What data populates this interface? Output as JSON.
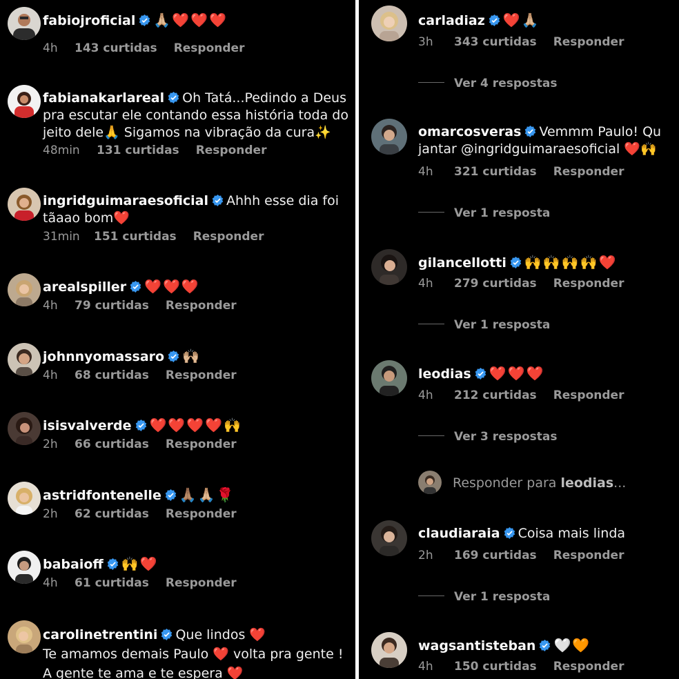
{
  "left": {
    "comments": [
      {
        "user": "fabiojroficial",
        "text": "",
        "emoji": "🙏🏼❤️❤️❤️",
        "time": "4h",
        "likes": "143 curtidas",
        "reply": "Responder"
      },
      {
        "user": "fabianakarlareal",
        "text": "Oh Tatá...Pedindo a Deus",
        "line2": "pra escutar ele contando essa história toda do",
        "line3": "jeito dele🙏 Sigamos na vibração da cura✨",
        "time": "48min",
        "likes": "131 curtidas",
        "reply": "Responder"
      },
      {
        "user": "ingridguimaraesoficial",
        "text": "Ahhh esse dia foi",
        "line2": "tãaao bom❤️",
        "time": "31min",
        "likes": "151 curtidas",
        "reply": "Responder"
      },
      {
        "user": "arealspiller",
        "text": "",
        "emoji": "❤️❤️❤️",
        "time": "4h",
        "likes": "79 curtidas",
        "reply": "Responder"
      },
      {
        "user": "johnnyomassaro",
        "text": "",
        "emoji": "🙌🏼",
        "time": "4h",
        "likes": "68 curtidas",
        "reply": "Responder"
      },
      {
        "user": "isisvalverde",
        "text": "",
        "emoji": "❤️❤️❤️❤️🙌",
        "time": "2h",
        "likes": "66 curtidas",
        "reply": "Responder"
      },
      {
        "user": "astridfontenelle",
        "text": "",
        "emoji": "🙏🏽🙏🏼🌹",
        "time": "2h",
        "likes": "62 curtidas",
        "reply": "Responder"
      },
      {
        "user": "babaioff",
        "text": "",
        "emoji": "🙌❤️",
        "time": "4h",
        "likes": "61 curtidas",
        "reply": "Responder"
      },
      {
        "user": "carolinetrentini",
        "text": "Que lindos ❤️",
        "line2": "Te amamos demais Paulo ❤️ volta pra gente !",
        "line3": "A gente te ama e te espera ❤️"
      }
    ]
  },
  "right": {
    "comments": [
      {
        "user": "carladiaz",
        "text": "",
        "emoji": "❤️🙏🏼",
        "time": "3h",
        "likes": "343 curtidas",
        "reply": "Responder",
        "view": "Ver 4 respostas"
      },
      {
        "user": "omarcosveras",
        "text": "Vemmm Paulo! Qu",
        "line2": "jantar @ingridguimaraesoficial ❤️🙌",
        "time": "4h",
        "likes": "321 curtidas",
        "reply": "Responder",
        "view": "Ver 1 resposta"
      },
      {
        "user": "gilancellotti",
        "text": "",
        "emoji": "🙌🙌🙌🙌❤️",
        "time": "4h",
        "likes": "279 curtidas",
        "reply": "Responder",
        "view": "Ver 1 resposta"
      },
      {
        "user": "leodias",
        "text": "",
        "emoji": "❤️❤️❤️",
        "time": "4h",
        "likes": "212 curtidas",
        "reply": "Responder",
        "view": "Ver 3 respostas"
      },
      {
        "user": "claudiaraia",
        "text": "Coisa mais linda",
        "time": "2h",
        "likes": "169 curtidas",
        "reply": "Responder",
        "view": "Ver 1 resposta"
      },
      {
        "user": "wagsantisteban",
        "text": "",
        "emoji": "🤍🧡",
        "time": "4h",
        "likes": "150 curtidas",
        "reply": "Responder"
      }
    ],
    "reply_input": {
      "prefix": "Responder para ",
      "target": "leodias",
      "suffix": "..."
    }
  },
  "colors": {
    "background": "#000000",
    "divider": "#ffffff",
    "verified": "#3897f0",
    "muted": "#9a9a9a",
    "heart": "#ee1d36"
  }
}
